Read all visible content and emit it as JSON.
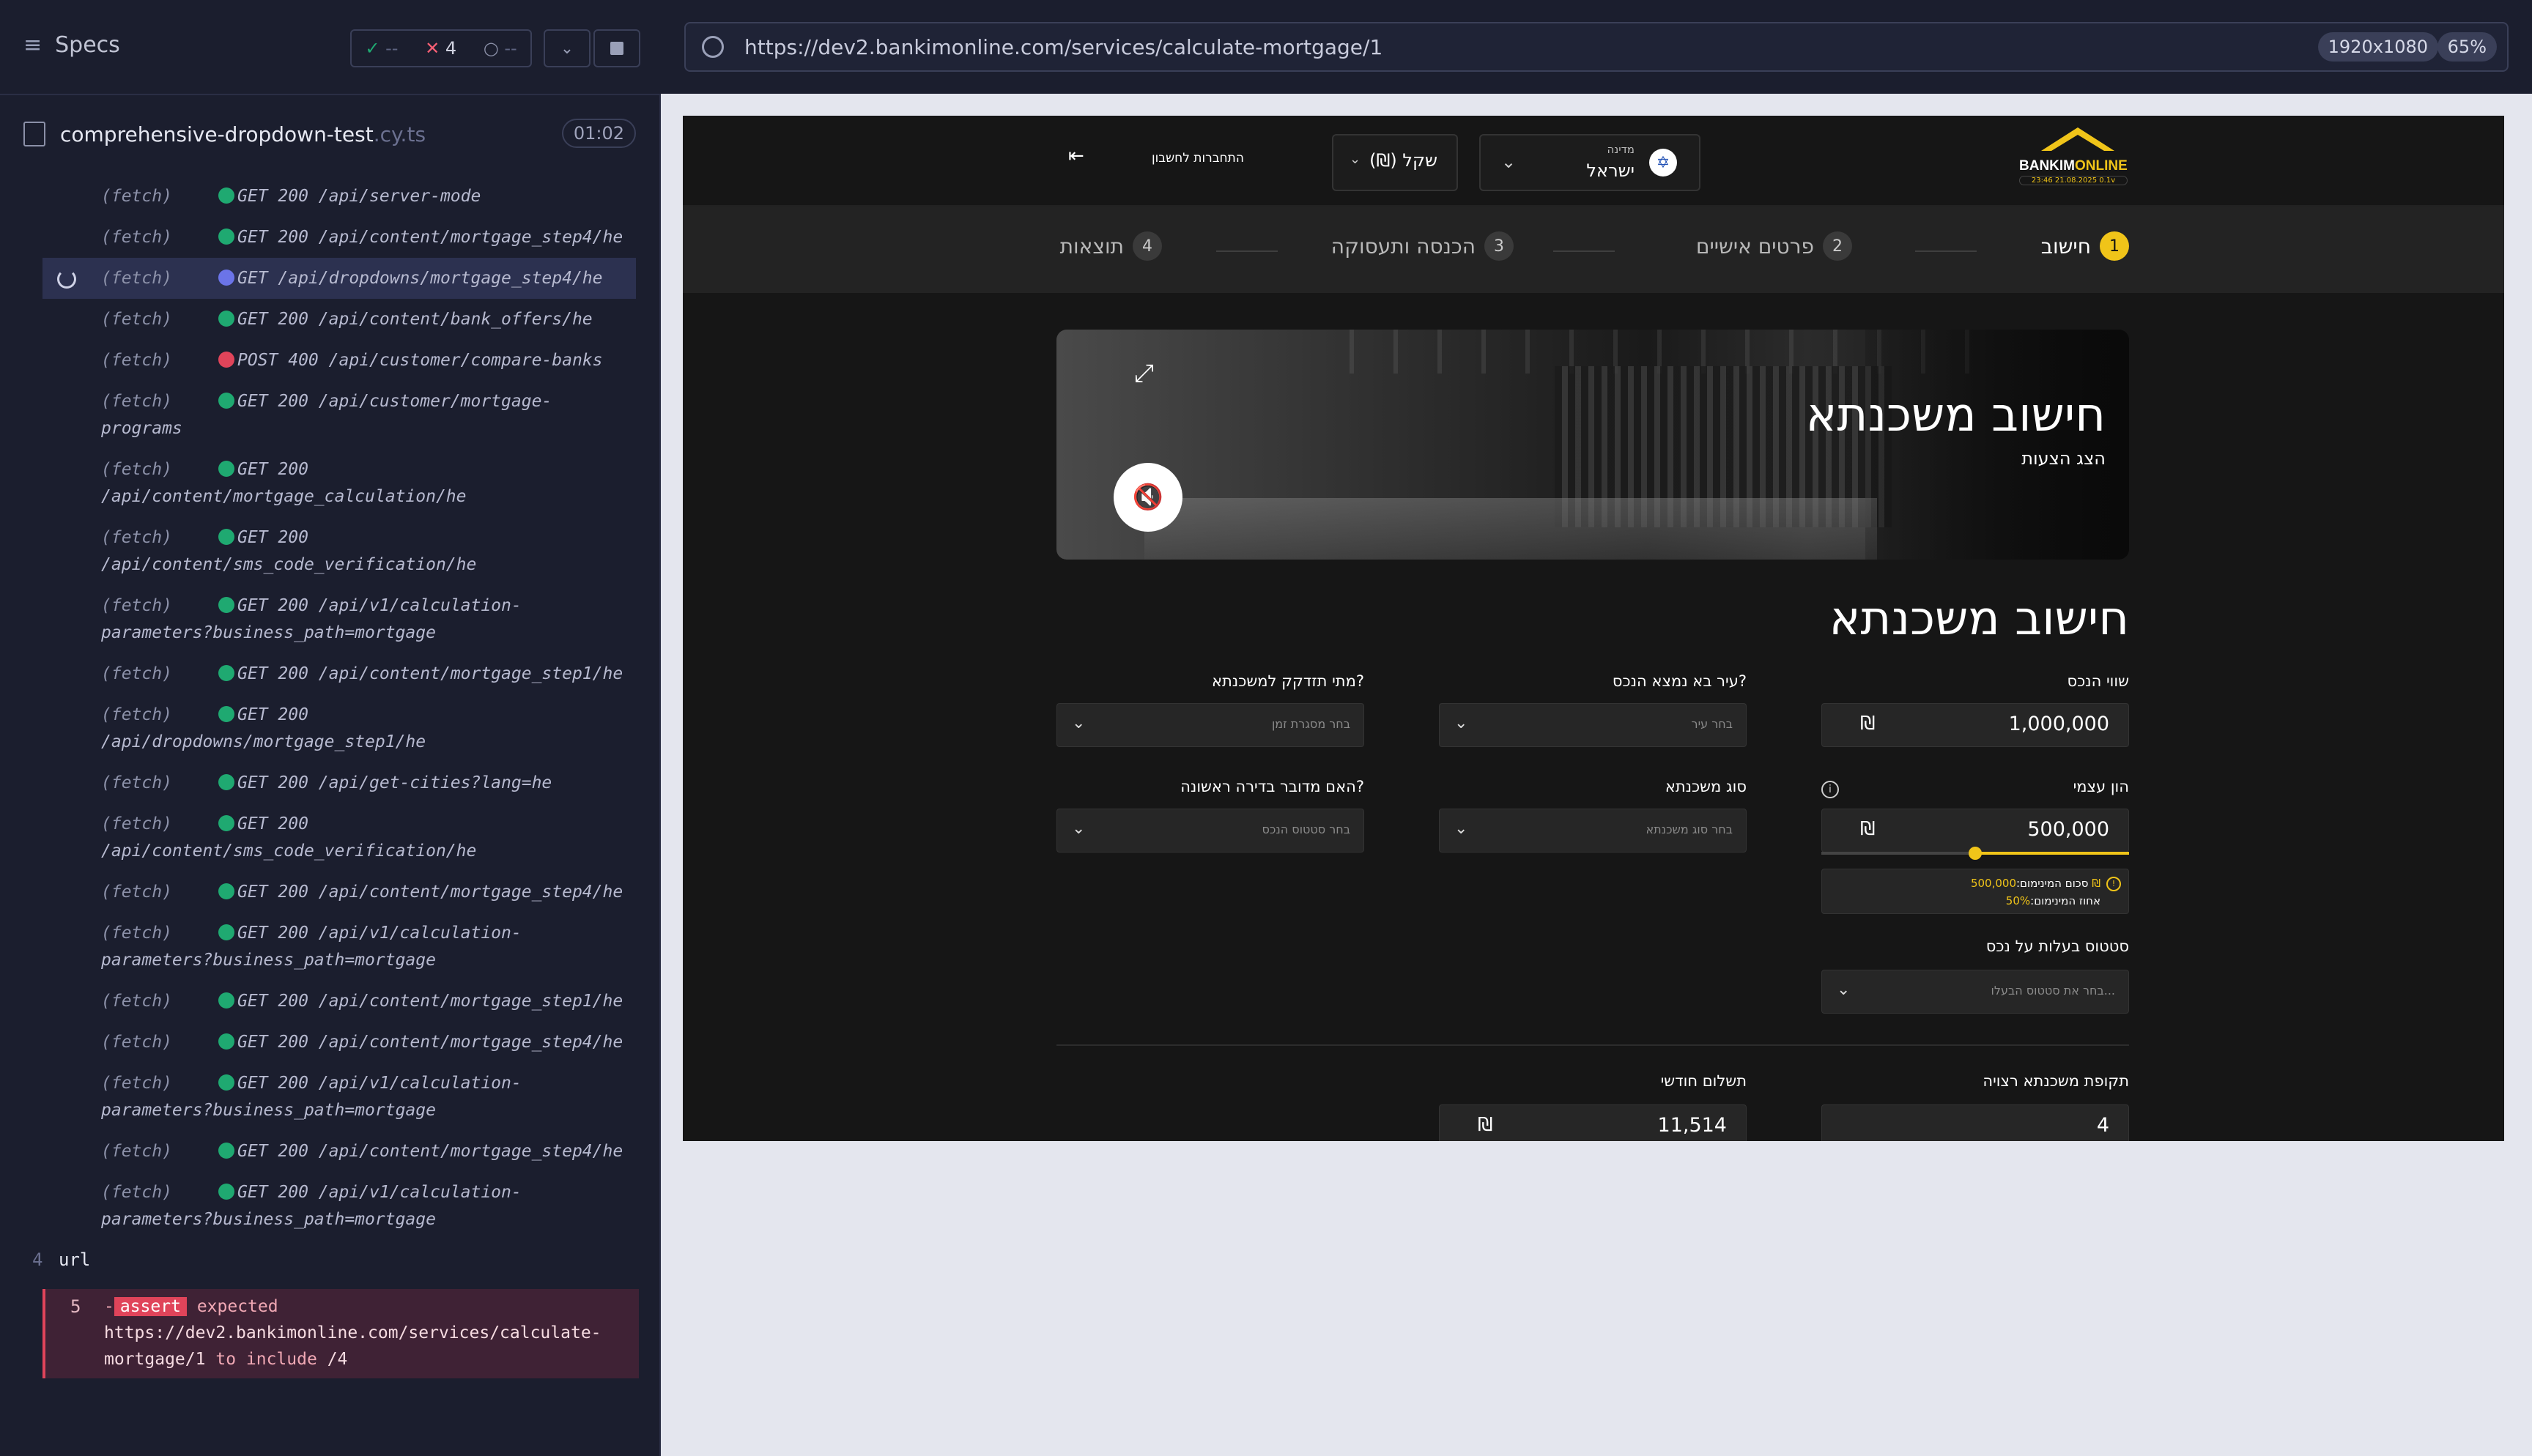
{
  "runner": {
    "specs_title": "Specs",
    "stats": {
      "pass_count": "--",
      "fail_count": "4",
      "pending_count": "--"
    },
    "file": {
      "name": "comprehensive-dropdown-test",
      "ext": ".cy.ts",
      "time": "01:02"
    },
    "commands": [
      {
        "label": "(fetch)",
        "status": "green",
        "text": "GET 200 /api/server-mode"
      },
      {
        "label": "(fetch)",
        "status": "green",
        "text": "GET 200 /api/content/mortgage_step4/he"
      },
      {
        "label": "(fetch)",
        "status": "blue",
        "text": "GET /api/dropdowns/mortgage_step4/he",
        "active": true
      },
      {
        "label": "(fetch)",
        "status": "green",
        "text": "GET 200 /api/content/bank_offers/he"
      },
      {
        "label": "(fetch)",
        "status": "red",
        "text": "POST 400 /api/customer/compare-banks"
      },
      {
        "label": "(fetch)",
        "status": "green",
        "text": "GET 200 /api/customer/mortgage-programs"
      },
      {
        "label": "(fetch)",
        "status": "green",
        "text": "GET 200 /api/content/mortgage_calculation/he"
      },
      {
        "label": "(fetch)",
        "status": "green",
        "text": "GET 200 /api/content/sms_code_verification/he"
      },
      {
        "label": "(fetch)",
        "status": "green",
        "text": "GET 200 /api/v1/calculation-parameters?business_path=mortgage"
      },
      {
        "label": "(fetch)",
        "status": "green",
        "text": "GET 200 /api/content/mortgage_step1/he"
      },
      {
        "label": "(fetch)",
        "status": "green",
        "text": "GET 200 /api/dropdowns/mortgage_step1/he"
      },
      {
        "label": "(fetch)",
        "status": "green",
        "text": "GET 200 /api/get-cities?lang=he"
      },
      {
        "label": "(fetch)",
        "status": "green",
        "text": "GET 200 /api/content/sms_code_verification/he"
      },
      {
        "label": "(fetch)",
        "status": "green",
        "text": "GET 200 /api/content/mortgage_step4/he"
      },
      {
        "label": "(fetch)",
        "status": "green",
        "text": "GET 200 /api/v1/calculation-parameters?business_path=mortgage"
      },
      {
        "label": "(fetch)",
        "status": "green",
        "text": "GET 200 /api/content/mortgage_step1/he"
      },
      {
        "label": "(fetch)",
        "status": "green",
        "text": "GET 200 /api/content/mortgage_step4/he"
      },
      {
        "label": "(fetch)",
        "status": "green",
        "text": "GET 200 /api/v1/calculation-parameters?business_path=mortgage"
      },
      {
        "label": "(fetch)",
        "status": "green",
        "text": "GET 200 /api/content/mortgage_step4/he"
      },
      {
        "label": "(fetch)",
        "status": "green",
        "text": "GET 200 /api/v1/calculation-parameters?business_path=mortgage"
      }
    ],
    "url_step": {
      "num": "4",
      "text": "url"
    },
    "assert_step": {
      "num": "5",
      "prefix": "-",
      "tag": "assert",
      "expected_word": "expected",
      "url": "https://dev2.bankimonline.com/services/calculate-mortgage/1",
      "to_include": "to include",
      "value": "/4"
    }
  },
  "browser": {
    "url": "https://dev2.bankimonline.com/services/calculate-mortgage/1",
    "viewport": "1920x1080",
    "zoom": "65%"
  },
  "app": {
    "logo": {
      "main": "BANKIM",
      "accent": "ONLINE",
      "sub": "23:46 21.08.2025 0.1v"
    },
    "country": {
      "label": "מדינה",
      "value": "ישראל"
    },
    "currency": {
      "value": "(₪) שקל"
    },
    "login": {
      "text": "התחברות לחשבון"
    },
    "steps": [
      {
        "num": "1",
        "label": "חישוב"
      },
      {
        "num": "2",
        "label": "פרטים אישיים"
      },
      {
        "num": "3",
        "label": "הכנסה ותעסוקה"
      },
      {
        "num": "4",
        "label": "תוצאות"
      }
    ],
    "hero": {
      "title": "חישוב משכנתא",
      "subtitle": "הצג הצעות"
    },
    "form_title": "חישוב משכנתא",
    "fields": {
      "property_value": {
        "label": "שווי הנכס",
        "value": "1,000,000",
        "currency": "₪"
      },
      "city": {
        "label": "עיר בא נמצא הנכס?",
        "placeholder": "בחר עיר"
      },
      "when_needed": {
        "label": "מתי תזדקק למשכנתא?",
        "placeholder": "בחר מסגרת זמן"
      },
      "own_capital": {
        "label": "הון עצמי",
        "value": "500,000",
        "currency": "₪",
        "slider_fraction": 0.5
      },
      "mortgage_type": {
        "label": "סוג משכנתא",
        "placeholder": "בחר סוג משכנתא"
      },
      "first_apartment": {
        "label": "האם מדובר בדירה ראשונה?",
        "placeholder": "בחר סטטוס הנכס"
      },
      "min_note": {
        "amount_label": "סכום המינימום:",
        "amount": "500,000 ₪",
        "pct_label": "אחוז המינימום:",
        "pct": "50%"
      },
      "ownership": {
        "label": "סטטוס בעלות על נכס",
        "placeholder": "בחר את סטטוס הבעלו..."
      },
      "period": {
        "label": "תקופת משכנתא רצויה",
        "value": "4"
      },
      "monthly": {
        "label": "תשלום חודשי",
        "value": "11,514",
        "currency": "₪"
      }
    }
  }
}
